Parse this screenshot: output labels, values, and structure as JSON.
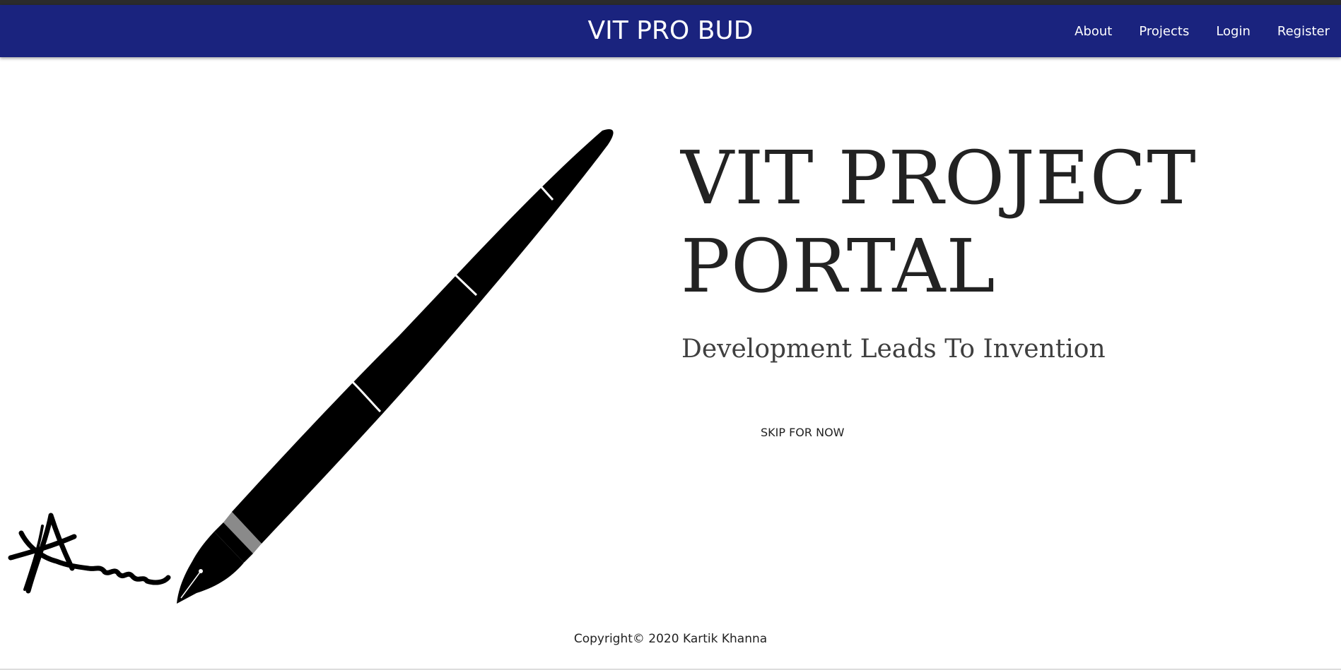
{
  "navbar": {
    "brand": "VIT PRO BUD",
    "links": [
      "About",
      "Projects",
      "Login",
      "Register"
    ],
    "background_color": "#1a237e"
  },
  "hero": {
    "title_line1": "VIT PROJECT",
    "title_line2": "PORTAL",
    "tagline": "Development Leads To Invention",
    "skip_label": "SKIP FOR NOW",
    "illustration": "fountain-pen-with-signature"
  },
  "footer": {
    "copyright": "Copyright© 2020 Kartik Khanna"
  }
}
